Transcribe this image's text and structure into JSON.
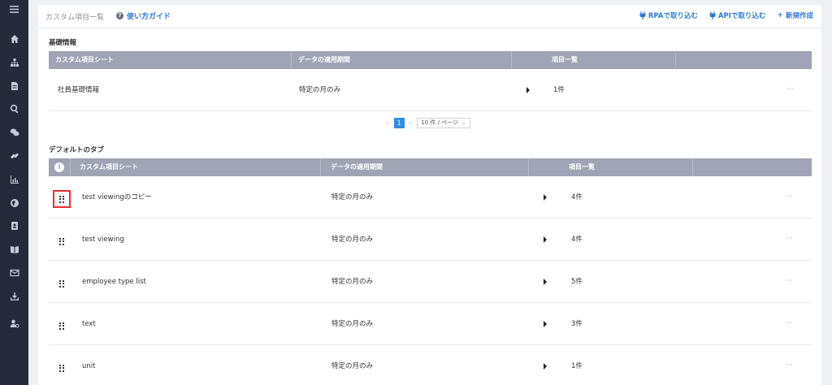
{
  "header": {
    "title": "カスタム項目一覧",
    "guide_label": "使い方ガイド",
    "actions": [
      {
        "label": "RPAで取り込む"
      },
      {
        "label": "APIで取り込む"
      },
      {
        "label": "新規作成",
        "prefix": "+"
      }
    ]
  },
  "basic": {
    "title": "基礎情報",
    "columns": [
      "カスタム項目シート",
      "データの適用期間",
      "項目一覧"
    ],
    "rows": [
      {
        "name": "社員基礎情報",
        "period": "特定の月のみ",
        "count": "1件",
        "more": "···"
      }
    ],
    "pager": {
      "prev": "‹",
      "page": "1",
      "next": "›",
      "page_size": "10 件 / ページ",
      "chevron": "⌄"
    }
  },
  "default_tabs": {
    "title": "デフォルトのタブ",
    "info": "i",
    "columns": [
      "カスタム項目シート",
      "データの適用期間",
      "項目一覧"
    ],
    "rows": [
      {
        "name": "test viewingのコピー",
        "period": "特定の月のみ",
        "count": "4件",
        "more": "···"
      },
      {
        "name": "test viewing",
        "period": "特定の月のみ",
        "count": "4件",
        "more": "···"
      },
      {
        "name": "employee type list",
        "period": "特定の月のみ",
        "count": "5件",
        "more": "···"
      },
      {
        "name": "text",
        "period": "特定の月のみ",
        "count": "3件",
        "more": "···"
      },
      {
        "name": "unit",
        "period": "特定の月のみ",
        "count": "1件",
        "more": "···"
      }
    ]
  },
  "sidebar": {
    "items": [
      "menu-icon",
      "home-icon",
      "org-chart-icon",
      "document-icon",
      "search-icon",
      "chat-icon",
      "link-icon",
      "chart-icon",
      "globe-icon",
      "contact-book-icon",
      "book-icon",
      "mail-icon",
      "download-icon",
      "user-settings-icon"
    ]
  },
  "colors": {
    "sidebar_bg": "#252b3c",
    "header_bg": "#9fa3b3",
    "accent": "#2f7ad6",
    "selection": "#e63030"
  }
}
